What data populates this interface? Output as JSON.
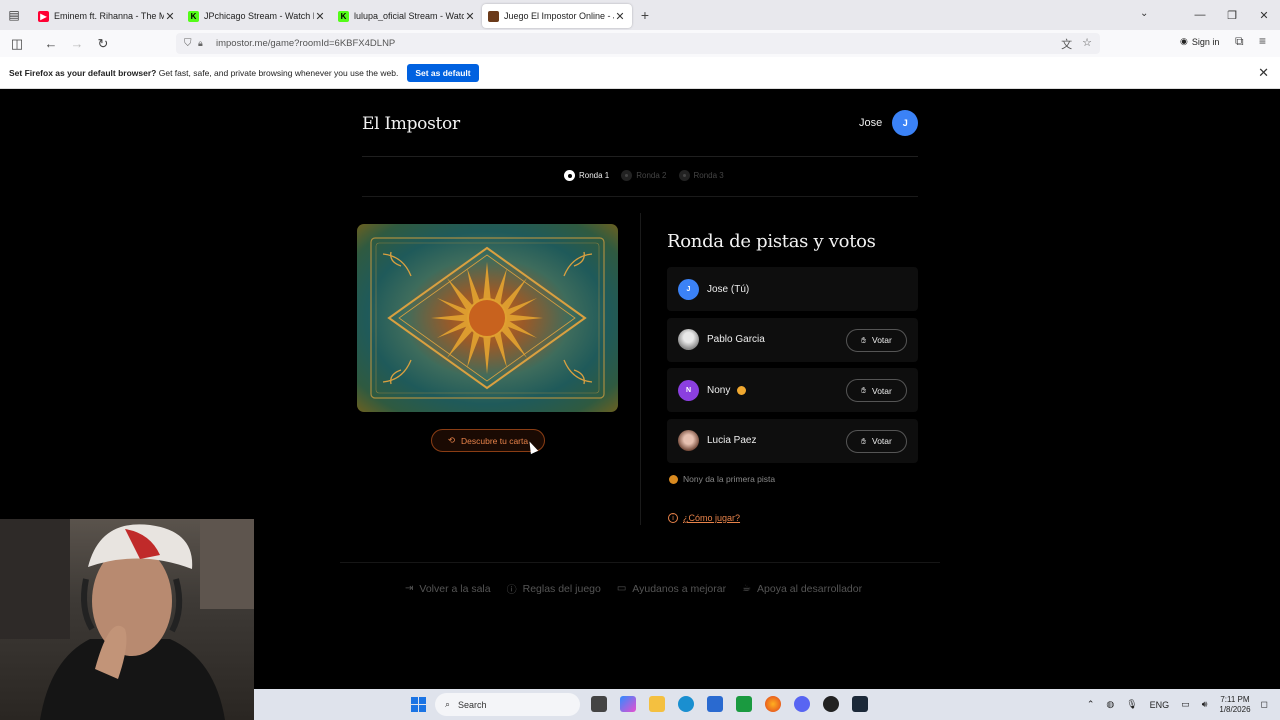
{
  "browser": {
    "tabs": [
      {
        "title": "Eminem ft. Rihanna - The Mons",
        "fav_color": "#ff0033"
      },
      {
        "title": "JPchicago Stream - Watch Live",
        "fav_color": "#53fc18"
      },
      {
        "title": "lulupa_oficial Stream - Watch Li",
        "fav_color": "#53fc18"
      },
      {
        "title": "Juego El Impostor Online - Jug",
        "fav_color": "#6b3a1a",
        "active": true
      }
    ],
    "url": "impostor.me/game?roomId=6KBFX4DLNP",
    "sign_in": "Sign in",
    "notification": {
      "bold": "Set Firefox as your default browser?",
      "text": "Get fast, safe, and private browsing whenever you use the web.",
      "button": "Set as default"
    }
  },
  "app": {
    "brand": "El Impostor",
    "user_name": "Jose",
    "user_initial": "J",
    "rounds": [
      "Ronda 1",
      "Ronda 2",
      "Ronda 3"
    ],
    "active_round": 1,
    "reveal_button": "Descubre tu carta",
    "section_title": "Ronda de pistas y votos",
    "players": [
      {
        "name": "Jose (Tú)",
        "initial": "J",
        "avatar_color": "#3b82f6",
        "can_vote": false
      },
      {
        "name": "Pablo Garcia",
        "initial": "",
        "avatar_color": "#bdbdbd",
        "can_vote": true
      },
      {
        "name": "Nony",
        "initial": "N",
        "avatar_color": "#8b3fe0",
        "can_vote": true,
        "turn": true
      },
      {
        "name": "Lucia Paez",
        "initial": "",
        "avatar_color": "#c9a090",
        "can_vote": true
      }
    ],
    "vote_label": "Votar",
    "hint_text": "Nony da la primera pista",
    "howto_label": "¿Cómo jugar?",
    "footer": [
      {
        "label": "Volver a la sala",
        "icon": "logout-icon"
      },
      {
        "label": "Reglas del juego",
        "icon": "info-icon"
      },
      {
        "label": "Ayudanos a mejorar",
        "icon": "message-icon"
      },
      {
        "label": "Apoya al desarrollador",
        "icon": "coffee-icon"
      }
    ]
  },
  "taskbar": {
    "search": "Search",
    "lang": "ENG",
    "time": "7:11 PM",
    "date": "1/8/2026"
  },
  "colors": {
    "accent": "#e8834a",
    "user_blue": "#3b82f6",
    "firefox_blue": "#0061e0"
  }
}
